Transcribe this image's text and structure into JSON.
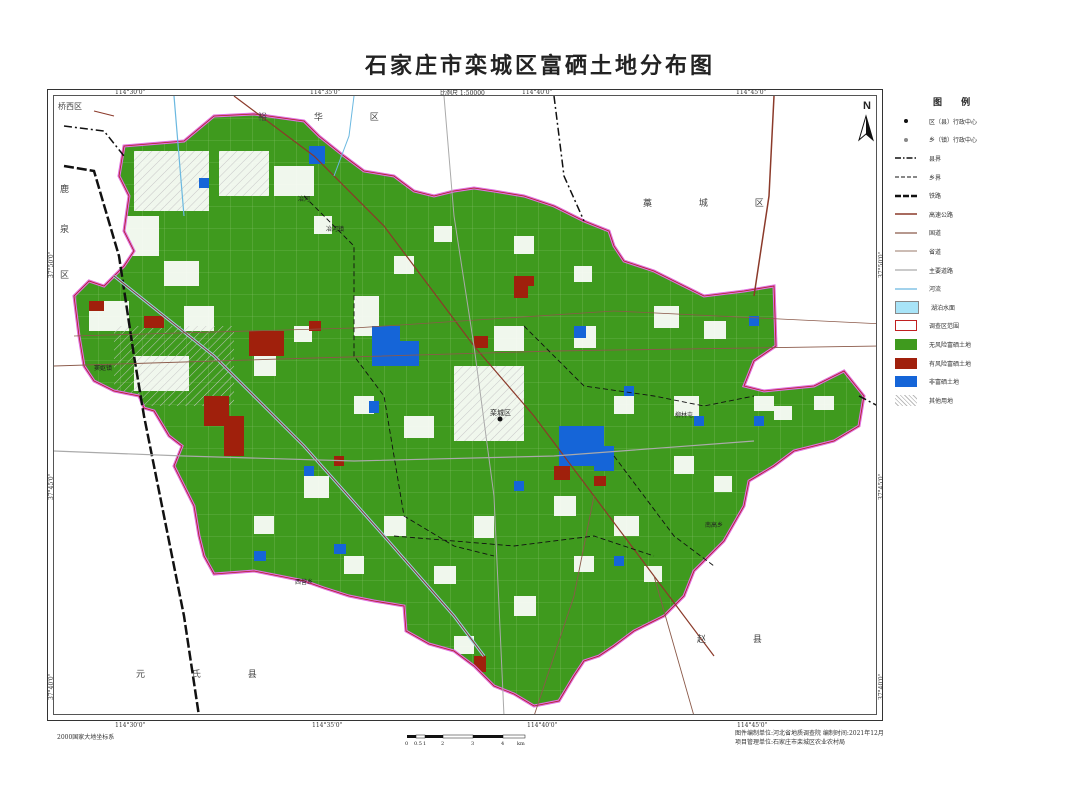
{
  "title": "石家庄市栾城区富硒土地分布图",
  "scale_top": "比例尺  1:50000",
  "coords": {
    "top": [
      "114°30'0\"",
      "114°35'0\"",
      "114°40'0\"",
      "114°45'0\""
    ],
    "bottom": [
      "114°30'0\"",
      "114°35'0\"",
      "114°40'0\"",
      "114°45'0\""
    ],
    "left": [
      "37°50'0\"",
      "37°45'0\"",
      "37°40'0\""
    ],
    "right": [
      "37°50'0\"",
      "37°45'0\"",
      "37°40'0\""
    ]
  },
  "neighbors": {
    "yuhua": "裕 华 区",
    "gaocheng": "藁 城 区",
    "zhaoxian": "赵 县",
    "yuanshi": "元 氏 县",
    "qiaoxi": "桥西区",
    "luquan": [
      "鹿",
      "泉",
      "区"
    ]
  },
  "towns": {
    "county_center": "栾城区",
    "yehe": "冶河镇",
    "doukou": "窦妪镇",
    "louding": "楼底镇",
    "nangao": "南高乡",
    "liucun": "柳林屯",
    "xigao": "西营乡",
    "lugou": "冶河"
  },
  "legend": {
    "title": "图 例",
    "items": [
      {
        "label": "区（县）行政中心",
        "symbol": "county-center-icon"
      },
      {
        "label": "乡（镇）行政中心",
        "symbol": "town-center-icon"
      },
      {
        "label": "县界",
        "symbol": "county-boundary"
      },
      {
        "label": "乡界",
        "symbol": "town-boundary"
      },
      {
        "label": "铁路",
        "symbol": "railway"
      },
      {
        "label": "高速公路",
        "symbol": "expressway"
      },
      {
        "label": "国道",
        "symbol": "national-road"
      },
      {
        "label": "省道",
        "symbol": "provincial-road"
      },
      {
        "label": "主要道路",
        "symbol": "main-road"
      },
      {
        "label": "河流",
        "symbol": "river"
      },
      {
        "label": "湖泊水面",
        "symbol": "lake"
      },
      {
        "label": "调查区范围",
        "symbol": "survey-area"
      },
      {
        "label": "无风险富硒土地",
        "symbol": "no-risk-selenium"
      },
      {
        "label": "有风险富硒土地",
        "symbol": "risk-selenium"
      },
      {
        "label": "非富硒土地",
        "symbol": "non-selenium"
      },
      {
        "label": "其他用地",
        "symbol": "other-land"
      }
    ]
  },
  "colors": {
    "no_risk": "#3f9a1e",
    "risk": "#a0200c",
    "non_selenium": "#1565d8",
    "lake": "#a8e4f8",
    "survey_border": "#e070e0",
    "expressway": "#8b3a2a",
    "railway": "#111111"
  },
  "scalebar": {
    "labels": [
      "0",
      "0.5",
      "1",
      "2",
      "3",
      "4"
    ],
    "unit": "km"
  },
  "footer": {
    "crs": "2000国家大地坐标系",
    "compiler": "图件编制单位:河北省地质调查院  编制时间:2021年12月",
    "manager": "项目管理单位:石家庄市栾城区农业农村局"
  },
  "compass": "N"
}
